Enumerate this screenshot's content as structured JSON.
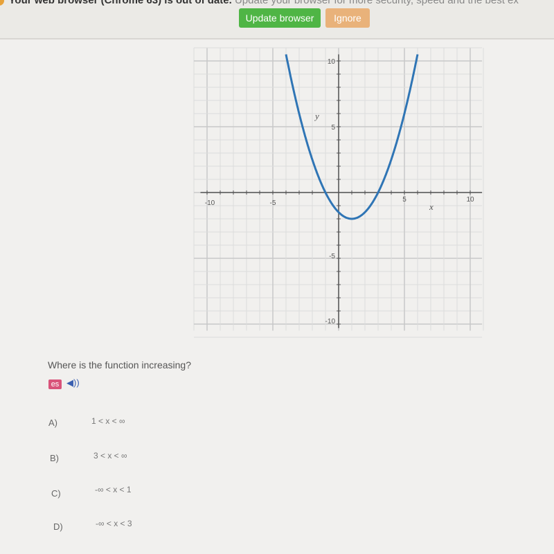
{
  "banner": {
    "message_bold": "Your web browser (Chrome 63) is out of date.",
    "message_rest": "Update your browser for more security, speed and the best ex",
    "update_label": "Update browser",
    "ignore_label": "Ignore",
    "update_color": "#4fb545",
    "ignore_color": "#e9b27a"
  },
  "chart_data": {
    "type": "line",
    "xlabel": "x",
    "ylabel": "y",
    "xlim": [
      -10,
      10
    ],
    "ylim": [
      -10,
      10
    ],
    "grid": true,
    "x_tick_labels": [
      "-10",
      "-5",
      "5",
      "10"
    ],
    "y_tick_labels": [
      "10",
      "5",
      "-5",
      "-10"
    ],
    "series": [
      {
        "color": "#2f75b5",
        "x": [
          -4,
          -3,
          -2,
          -1,
          0,
          1,
          2,
          3,
          4,
          5,
          6
        ],
        "y": [
          10.5,
          6,
          2.5,
          0,
          -1.5,
          -2,
          -1.5,
          0,
          2.5,
          6,
          10.5
        ]
      }
    ]
  },
  "question": {
    "text": "Where is the function increasing?",
    "lang_badge": "es",
    "audio_icon": "speaker-icon",
    "options": [
      {
        "letter": "A)",
        "value": "1 < x < ∞"
      },
      {
        "letter": "B)",
        "value": "3 < x < ∞"
      },
      {
        "letter": "C)",
        "value": "-∞ < x < 1"
      },
      {
        "letter": "D)",
        "value": "-∞ < x < 3"
      }
    ]
  }
}
